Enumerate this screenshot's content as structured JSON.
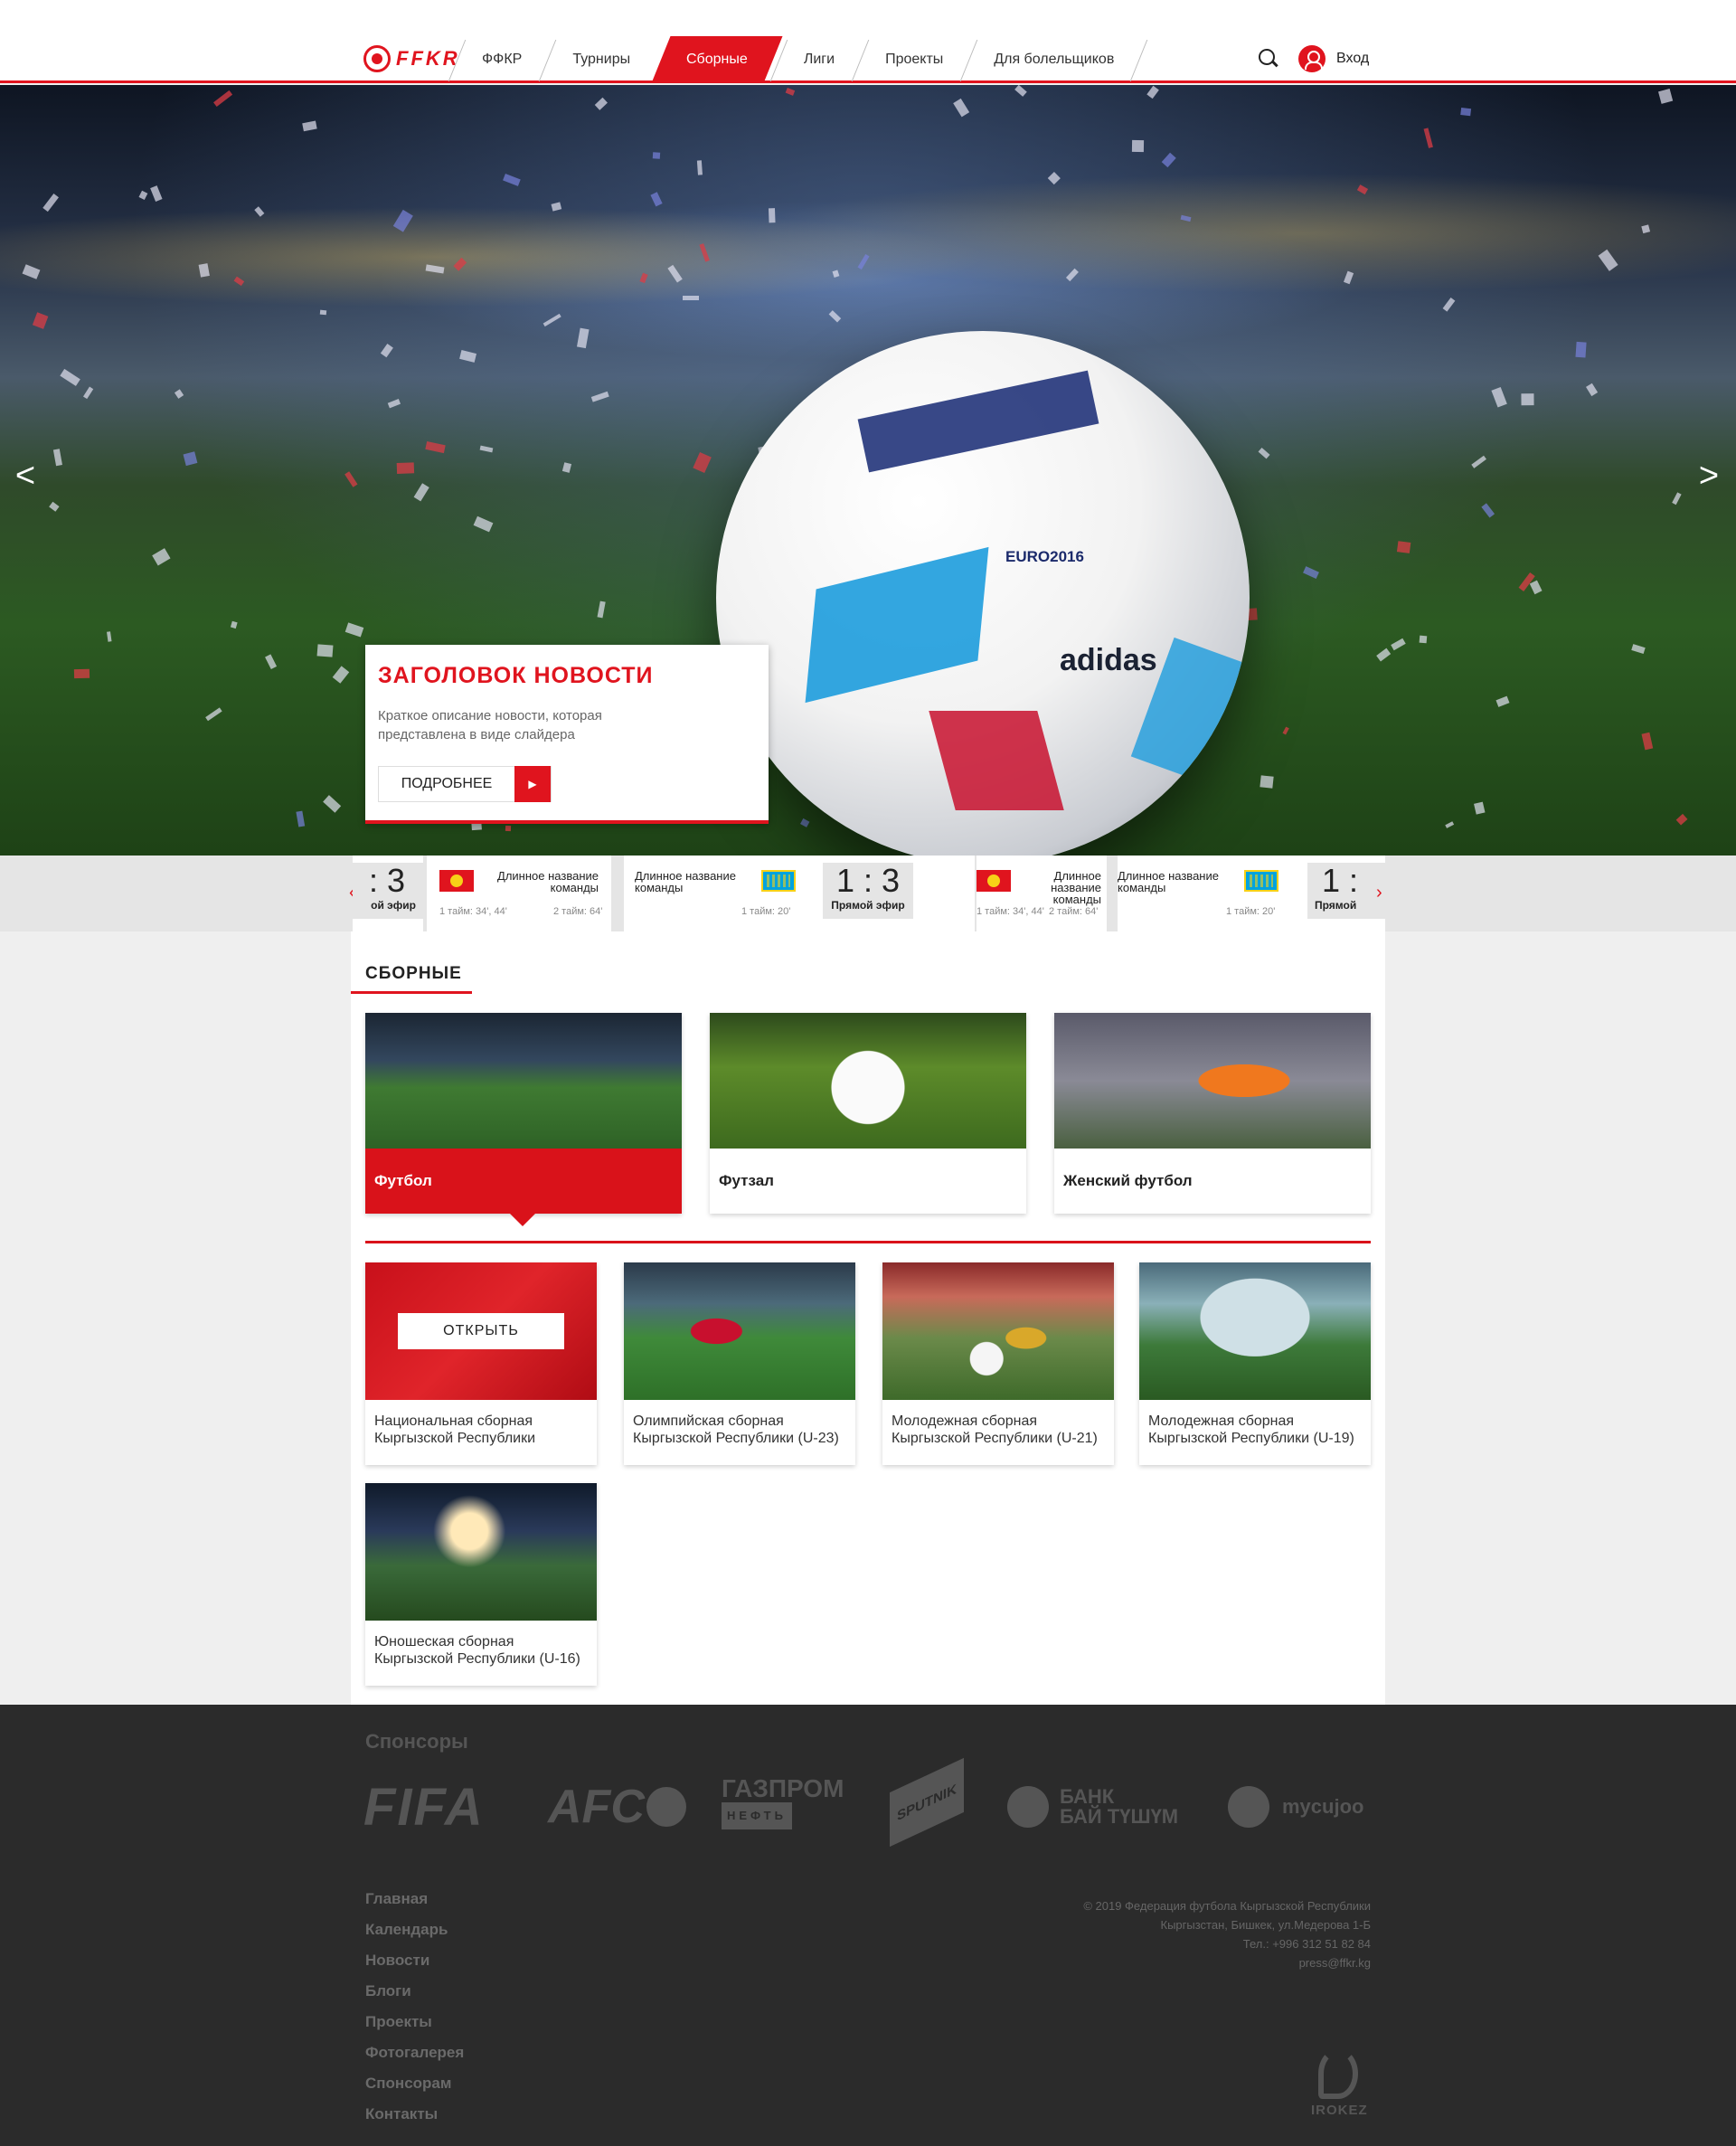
{
  "header": {
    "logo_text": "FFKR",
    "nav": [
      "ФФКР",
      "Турниры",
      "Сборные",
      "Лиги",
      "Проекты",
      "Для болельщиков"
    ],
    "active_nav": "Сборные",
    "login_label": "Вход"
  },
  "hero": {
    "ball_brand": "adidas",
    "ball_event": "EURO2016",
    "title": "ЗАГОЛОВОК НОВОСТИ",
    "description": "Краткое описание новости, которая представлена в виде слайдера",
    "button_label": "ПОДРОБНЕЕ",
    "prev_arrow": "<",
    "next_arrow": ">"
  },
  "ticker": {
    "team_name": "Длинное название команды",
    "score": "1 : 3",
    "score_partial": ": 3",
    "score_partial_right": "1 :",
    "live_label": "Прямой эфир",
    "live_partial_left": "ой эфир",
    "live_partial_right": "Прямой",
    "time_first": "1 тайм: 34', 44'",
    "time_second": "2 тайм: 64'",
    "time_single": "1 тайм: 20'"
  },
  "section": {
    "title": "СБОРНЫЕ",
    "categories": [
      {
        "label": "Футбол",
        "active": true
      },
      {
        "label": "Футзал",
        "active": false
      },
      {
        "label": "Женский футбол",
        "active": false
      }
    ],
    "open_label": "ОТКРЫТЬ",
    "teams": [
      {
        "label": "Национальная сборная Кыргызской Республики"
      },
      {
        "label": "Олимпийская сборная Кыргызской Республики (U-23)"
      },
      {
        "label": "Молодежная сборная Кыргызской Республики (U-21)"
      },
      {
        "label": "Молодежная сборная Кыргызской Республики (U-19)"
      },
      {
        "label": "Юношеская сборная Кыргызской Республики (U-16)"
      }
    ]
  },
  "footer": {
    "sponsors_title": "Спонсоры",
    "sponsors": {
      "fifa": "FIFA",
      "afc": "AFC",
      "gazprom_1": "ГАЗПРОМ",
      "gazprom_2": "НЕФТЬ",
      "sputnik": "SPUTNIK",
      "bank_1": "БАНК",
      "bank_2": "БАЙ ТҮШҮМ",
      "mycujoo": "mycujoo"
    },
    "links": [
      "Главная",
      "Календарь",
      "Новости",
      "Блоги",
      "Проекты",
      "Фотогалерея",
      "Спонсорам",
      "Контакты"
    ],
    "info": [
      "© 2019 Федерация футбола Кыргызской Республики",
      "Кыргызстан, Бишкек, ул.Медерова 1-Б",
      "Тел.: +996 312 51 82 84",
      "press@ffkr.kg"
    ],
    "studio": "IROKEZ"
  },
  "colors": {
    "accent": "#e0141e",
    "footer_bg": "#2b2b2b"
  }
}
